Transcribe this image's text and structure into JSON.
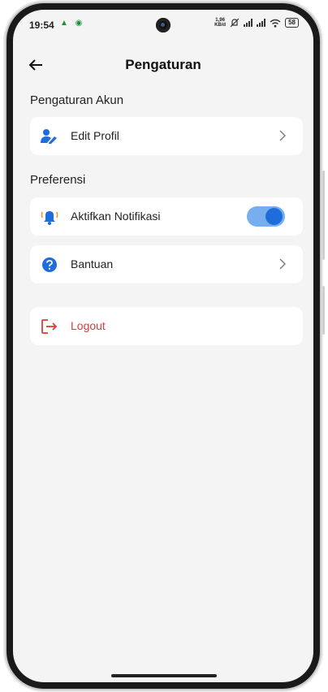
{
  "status_bar": {
    "time": "19:54",
    "left_icons": "▲ ◉",
    "net_speed_value": "1,96",
    "net_speed_unit": "KB/d",
    "battery": "58"
  },
  "app_bar": {
    "title": "Pengaturan",
    "back_icon": "arrow-left-icon"
  },
  "sections": {
    "account": {
      "title": "Pengaturan Akun",
      "items": [
        {
          "label": "Edit Profil",
          "icon": "user-edit-icon"
        }
      ]
    },
    "preferences": {
      "title": "Preferensi",
      "items": [
        {
          "label": "Aktifkan Notifikasi",
          "icon": "bell-ring-icon",
          "toggle_on": true
        },
        {
          "label": "Bantuan",
          "icon": "help-circle-icon"
        }
      ]
    },
    "logout": {
      "label": "Logout",
      "icon": "logout-icon"
    }
  },
  "colors": {
    "accent": "#1e6ddb",
    "toggle_track": "#77aef0",
    "danger": "#e03a3a",
    "background": "#f4f4f4",
    "card": "#ffffff"
  }
}
